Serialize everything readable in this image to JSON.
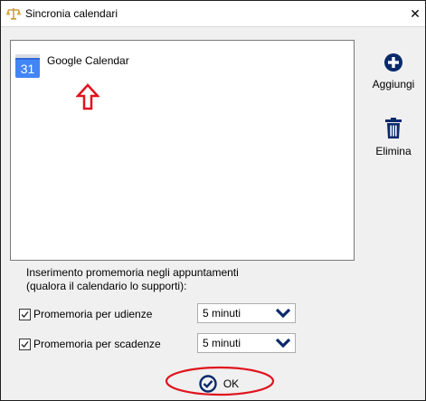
{
  "window": {
    "title": "Sincronia calendari",
    "close_label": "✕"
  },
  "calendars": [
    {
      "label": "Google Calendar",
      "icon_text": "31",
      "icon": "google-calendar-icon"
    }
  ],
  "sidebar": {
    "add_label": "Aggiungi",
    "delete_label": "Elimina"
  },
  "reminders": {
    "info_line1": "Inserimento promemoria negli appuntamenti",
    "info_line2": "(qualora il calendario lo supporti):",
    "hearings_label": "Promemoria per udienze",
    "hearings_checked": true,
    "hearings_value": "5 minuti",
    "deadlines_label": "Promemoria per scadenze",
    "deadlines_checked": true,
    "deadlines_value": "5 minuti"
  },
  "footer": {
    "ok_label": "OK"
  },
  "colors": {
    "accent": "#0b2a6b",
    "annotation_red": "#e0141e",
    "google_blue": "#4285f4"
  }
}
